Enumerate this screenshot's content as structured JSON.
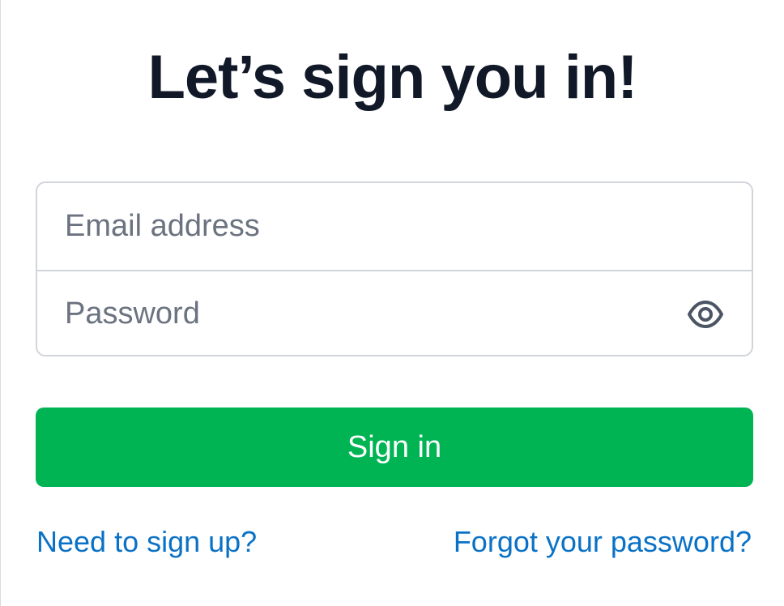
{
  "heading": "Let’s sign you in!",
  "form": {
    "email_placeholder": "Email address",
    "password_placeholder": "Password",
    "show_password_icon": "eye-icon",
    "submit_label": "Sign in"
  },
  "links": {
    "sign_up": "Need to sign up?",
    "forgot_password": "Forgot your password?"
  },
  "colors": {
    "primary_button": "#00b454",
    "link": "#0a72c6",
    "heading": "#111827",
    "placeholder": "#6b7280",
    "border": "#d1d5db"
  }
}
